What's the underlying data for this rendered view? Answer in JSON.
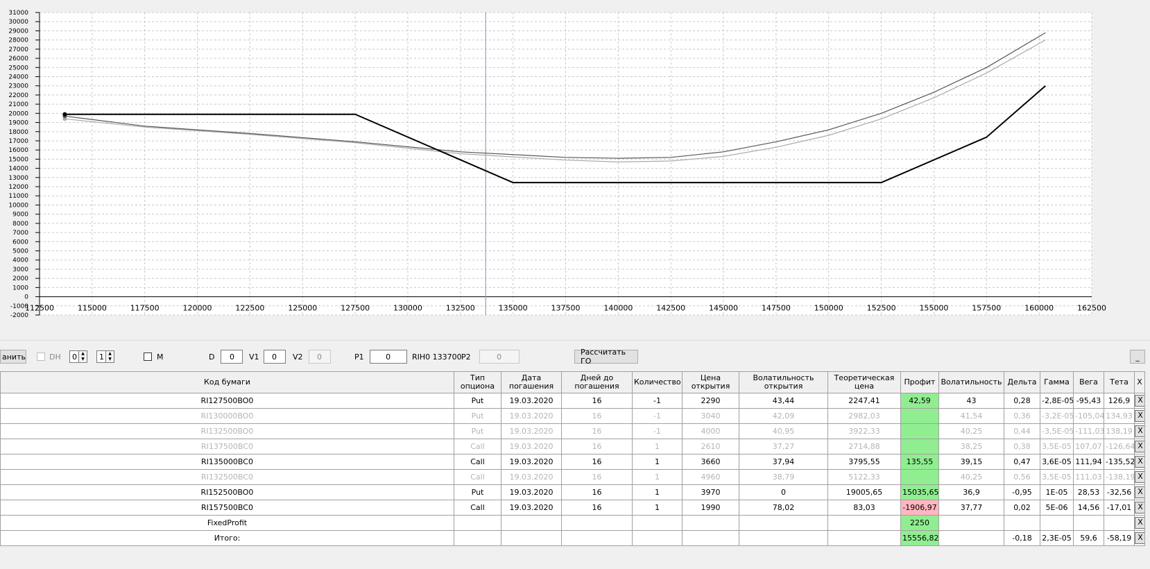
{
  "chart_data": {
    "type": "line",
    "x_ticks": [
      112500,
      115000,
      117500,
      120000,
      122500,
      125000,
      127500,
      130000,
      132500,
      135000,
      137500,
      140000,
      142500,
      145000,
      147500,
      150000,
      152500,
      155000,
      157500,
      160000,
      162500
    ],
    "y_ticks": [
      -2000,
      -1000,
      0,
      1000,
      2000,
      3000,
      4000,
      5000,
      6000,
      7000,
      8000,
      9000,
      10000,
      11000,
      12000,
      13000,
      14000,
      15000,
      16000,
      17000,
      18000,
      19000,
      20000,
      21000,
      22000,
      23000,
      24000,
      25000,
      26000,
      27000,
      28000,
      29000,
      30000,
      31000
    ],
    "xlim": [
      112500,
      162500
    ],
    "ylim": [
      -2000,
      31000
    ],
    "grid": true,
    "current_price_x": 133700,
    "series": [
      {
        "color": "#000000",
        "x": [
          113700,
          127500,
          135000,
          152500,
          157500,
          160300
        ],
        "y": [
          19900,
          19900,
          12450,
          12450,
          17400,
          23000
        ]
      },
      {
        "color": "#555555",
        "x": [
          113700,
          117500,
          122500,
          127500,
          132500,
          137500,
          140000,
          142500,
          145000,
          147500,
          150000,
          152500,
          155000,
          157500,
          160300
        ],
        "y": [
          19700,
          18600,
          17800,
          16900,
          15800,
          15200,
          15100,
          15200,
          15800,
          16900,
          18200,
          20000,
          22300,
          25000,
          28800
        ]
      },
      {
        "color": "#aaaaaa",
        "x": [
          113700,
          117500,
          122500,
          127500,
          132500,
          137500,
          140000,
          142500,
          145000,
          147500,
          150000,
          152500,
          155000,
          157500,
          160300
        ],
        "y": [
          19400,
          18500,
          17700,
          16800,
          15600,
          14900,
          14700,
          14800,
          15300,
          16300,
          17600,
          19400,
          21700,
          24400,
          28000
        ]
      }
    ]
  },
  "toolbar": {
    "save_label": "анить",
    "dh_label": "DH",
    "spin1_value": "0",
    "spin2_value": "1",
    "m_label": "M",
    "d_label": "D",
    "d_value": "0",
    "v1_label": "V1",
    "v1_value": "0",
    "v2_label": "V2",
    "v2_value": "0",
    "p1_label": "P1",
    "p1_value": "0",
    "instrument": "RIH0 133700",
    "p2_label": "P2",
    "p2_value": "0",
    "calc_label": "Рассчитать ГО",
    "minimize_label": "_"
  },
  "grid": {
    "headers": [
      "Код бумаги",
      "Тип опциона",
      "Дата погашения",
      "Дней до погашения",
      "Количество",
      "Цена открытия",
      "Волатильность открытия",
      "Теоретическая цена",
      "Профит",
      "Волатильность",
      "Дельта",
      "Гамма",
      "Вега",
      "Тета",
      "X"
    ],
    "rows": [
      {
        "dim": false,
        "cells": [
          "RI127500BO0",
          "Put",
          "19.03.2020",
          "16",
          "-1",
          "2290",
          "43,44",
          "2247,41",
          "42,59",
          "43",
          "0,28",
          "-2,8E-05",
          "-95,43",
          "126,9"
        ],
        "profit": "pos"
      },
      {
        "dim": true,
        "cells": [
          "RI130000BO0",
          "Put",
          "19.03.2020",
          "16",
          "-1",
          "3040",
          "42,09",
          "2982,03",
          "",
          "41,54",
          "0,36",
          "-3,2E-05",
          "-105,04",
          "134,93"
        ],
        "profit": "pos"
      },
      {
        "dim": true,
        "cells": [
          "RI132500BO0",
          "Put",
          "19.03.2020",
          "16",
          "-1",
          "4000",
          "40,95",
          "3922,33",
          "",
          "40,25",
          "0,44",
          "-3,5E-05",
          "-111,03",
          "138,19"
        ],
        "profit": "pos"
      },
      {
        "dim": true,
        "cells": [
          "RI137500BC0",
          "Call",
          "19.03.2020",
          "16",
          "1",
          "2610",
          "37,27",
          "2714,88",
          "",
          "38,25",
          "0,38",
          "3,5E-05",
          "107,07",
          "-126,64"
        ],
        "profit": "pos"
      },
      {
        "dim": false,
        "cells": [
          "RI135000BC0",
          "Call",
          "19.03.2020",
          "16",
          "1",
          "3660",
          "37,94",
          "3795,55",
          "135,55",
          "39,15",
          "0,47",
          "3,6E-05",
          "111,94",
          "-135,52"
        ],
        "profit": "pos"
      },
      {
        "dim": true,
        "cells": [
          "RI132500BC0",
          "Call",
          "19.03.2020",
          "16",
          "1",
          "4960",
          "38,79",
          "5122,33",
          "",
          "40,25",
          "0,56",
          "3,5E-05",
          "111,03",
          "-138,19"
        ],
        "profit": "pos"
      },
      {
        "dim": false,
        "cells": [
          "RI152500BO0",
          "Put",
          "19.03.2020",
          "16",
          "1",
          "3970",
          "0",
          "19005,65",
          "15035,65",
          "36,9",
          "-0,95",
          "1E-05",
          "28,53",
          "-32,56"
        ],
        "profit": "pos"
      },
      {
        "dim": false,
        "cells": [
          "RI157500BC0",
          "Call",
          "19.03.2020",
          "16",
          "1",
          "1990",
          "78,02",
          "83,03",
          "-1906,97",
          "37,77",
          "0,02",
          "5E-06",
          "14,56",
          "-17,01"
        ],
        "profit": "neg"
      },
      {
        "dim": false,
        "cells": [
          "FixedProfit",
          "",
          "",
          "",
          "",
          "",
          "",
          "",
          "2250",
          "",
          "",
          "",
          "",
          ""
        ],
        "profit": "pos"
      },
      {
        "dim": false,
        "cells": [
          "Итого:",
          "",
          "",
          "",
          "",
          "",
          "",
          "",
          "15556,82",
          "",
          "-0,18",
          "2,3E-05",
          "59,6",
          "-58,19"
        ],
        "profit": "pos"
      }
    ],
    "x_label": "X"
  }
}
